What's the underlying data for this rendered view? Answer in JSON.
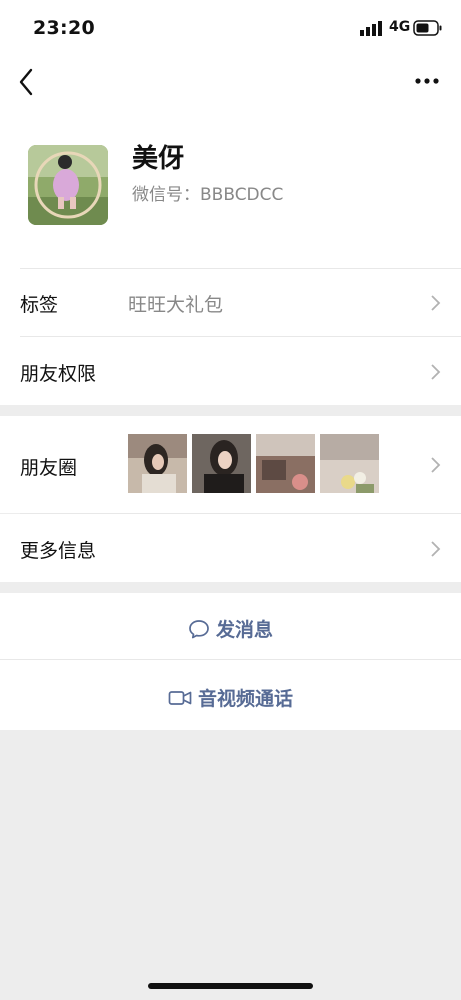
{
  "status_bar": {
    "time": "23:20",
    "network": "4G"
  },
  "profile": {
    "nickname": "美伢",
    "wechat_id": "微信号：BBBCDCC"
  },
  "rows": {
    "tags": {
      "label": "标签",
      "value": "旺旺大礼包"
    },
    "permissions": {
      "label": "朋友权限"
    },
    "moments": {
      "label": "朋友圈"
    },
    "more_info": {
      "label": "更多信息"
    }
  },
  "actions": {
    "message": "发消息",
    "video_call": "音视频通话"
  },
  "colors": {
    "accent": "#576b95",
    "background": "#ededed"
  },
  "icons": [
    "back-arrow-icon",
    "more-dots-icon",
    "chevron-right-icon",
    "chat-bubble-icon",
    "video-camera-icon"
  ]
}
